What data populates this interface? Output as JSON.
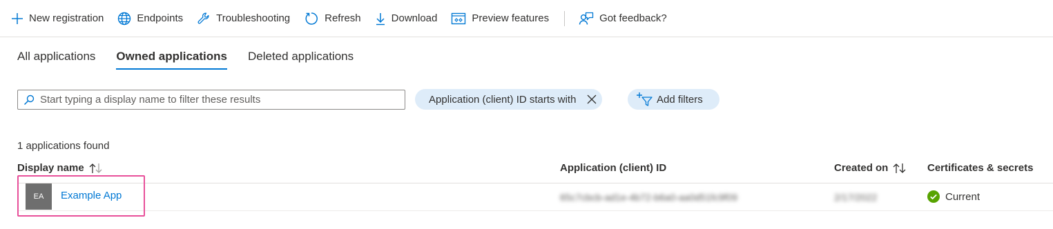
{
  "toolbar": {
    "new_registration": "New registration",
    "endpoints": "Endpoints",
    "troubleshooting": "Troubleshooting",
    "refresh": "Refresh",
    "download": "Download",
    "preview_features": "Preview features",
    "got_feedback": "Got feedback?"
  },
  "tabs": {
    "all": "All applications",
    "owned": "Owned applications",
    "deleted": "Deleted applications",
    "active": "Owned applications"
  },
  "search": {
    "placeholder": "Start typing a display name to filter these results",
    "value": ""
  },
  "filters": {
    "active_filter": "Application (client) ID starts with",
    "add_filters": "Add filters"
  },
  "results": {
    "count_text": "1 applications found"
  },
  "table": {
    "columns": {
      "display_name": "Display name",
      "client_id": "Application (client) ID",
      "created_on": "Created on",
      "certs": "Certificates & secrets"
    },
    "rows": [
      {
        "initials": "EA",
        "display_name": "Example App",
        "client_id": "65c7cbcb-ad1e-4b72-b6a0-aa0d51fc9f09",
        "created_on": "2/17/2022",
        "certs_status": "Current"
      }
    ]
  },
  "colors": {
    "accent": "#0078d4",
    "pill_bg": "#deecf9",
    "highlight": "#e8509a",
    "success": "#57a300"
  }
}
